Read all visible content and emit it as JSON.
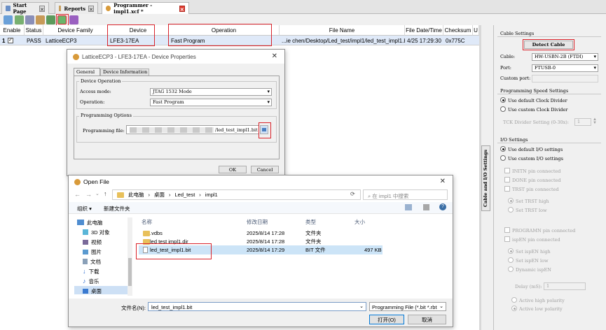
{
  "tabs": [
    {
      "label": "Start Page"
    },
    {
      "label": "Reports"
    },
    {
      "label": "Programmer - impl1.xcf *"
    }
  ],
  "grid": {
    "headers": [
      "Enable",
      "Status",
      "Device Family",
      "Device",
      "Operation",
      "File Name",
      "File Date/Time",
      "Checksum",
      "U"
    ],
    "row": {
      "index": "1",
      "status": "PASS",
      "family": "LatticeECP3",
      "device": "LFE3-17EA",
      "operation": "Fast Program",
      "file_name": "...ie chen/Desktop/Led_test/impl1/led_test_impl1.bit",
      "datetime": "4/25 17:29:30",
      "checksum": "0x775C"
    }
  },
  "device_props": {
    "title": "LatticeECP3 - LFE3-17EA - Device Properties",
    "tab_general": "General",
    "tab_info": "Device Information",
    "group_op": "Device Operation",
    "access_label": "Access mode:",
    "access_value": "JTAG 1532 Mode",
    "operation_label": "Operation:",
    "operation_value": "Fast Program",
    "group_prog": "Programming Options",
    "file_label": "Programming file:",
    "file_value": "/led_test_impl1.bit",
    "ok": "OK",
    "cancel": "Cancel"
  },
  "open_file": {
    "title": "Open File",
    "breadcrumb": [
      "此电脑",
      "桌面",
      "Led_test",
      "impl1"
    ],
    "search_placeholder": "在 impl1 中搜索",
    "organize": "组织 ▾",
    "new_folder": "新建文件夹",
    "nav": [
      "此电脑",
      "3D 对象",
      "视频",
      "图片",
      "文档",
      "下载",
      "音乐",
      "桌面"
    ],
    "columns": [
      "名称",
      "修改日期",
      "类型",
      "大小"
    ],
    "files": [
      {
        "name": ".vdbs",
        "date": "2025/8/14 17:28",
        "type": "文件夹",
        "size": ""
      },
      {
        "name": "led test impl1.dir",
        "date": "2025/8/14 17:28",
        "type": "文件夹",
        "size": ""
      },
      {
        "name": "led_test_impl1.bit",
        "date": "2025/8/14 17:29",
        "type": "BIT 文件",
        "size": "497 KB"
      }
    ],
    "filename_label": "文件名(N):",
    "filename_value": "led_test_impl1.bit",
    "filter": "Programming File (*.bit *.rbt",
    "open": "打开(O)",
    "cancel": "取消"
  },
  "cable": {
    "vertical_tab": "Cable and I/O Settings",
    "cable_settings": "Cable Settings",
    "detect": "Detect Cable",
    "cable_label": "Cable:",
    "cable_value": "HW-USBN-2B (FTDI)",
    "port_label": "Port:",
    "port_value": "FTUSB-0",
    "custom_port": "Custom port:",
    "speed_title": "Programming Speed Settings",
    "speed_default": "Use default Clock Divider",
    "speed_custom": "Use custom Clock Divider",
    "tck_label": "TCK Divider Setting (0-30x):",
    "tck_value": "1",
    "io_title": "I/O Settings",
    "io_default": "Use default I/O settings",
    "io_custom": "Use custom I/O settings",
    "initn": "INITN pin connected",
    "done": "DONE pin connected",
    "trst": "TRST pin connected",
    "trst_high": "Set TRST high",
    "trst_low": "Set TRST low",
    "programn": "PROGRAMN pin connected",
    "ispen": "ispEN pin connected",
    "ispen_high": "Set ispEN high",
    "ispen_low": "Set ispEN low",
    "dynamic": "Dynamic ispEN",
    "delay_label": "Delay (mS):",
    "delay_value": "1",
    "active_high": "Active high polarity",
    "active_low": "Active low polarity"
  }
}
